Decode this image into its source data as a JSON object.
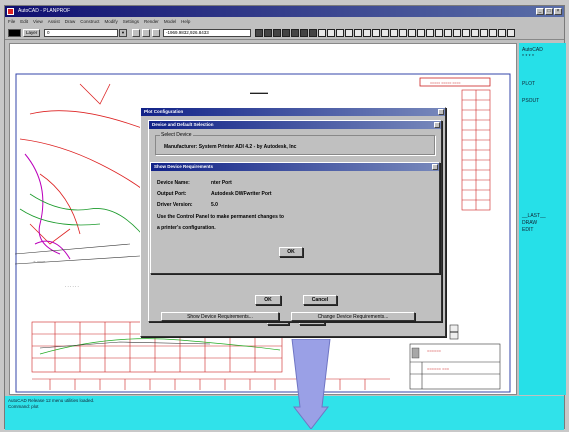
{
  "window": {
    "title": "AutoCAD - PLANPROF",
    "controls": [
      "_",
      "□",
      "×"
    ]
  },
  "menu": [
    "File",
    "Edit",
    "View",
    "Assist",
    "Draw",
    "Construct",
    "Modify",
    "Settings",
    "Render",
    "Model",
    "Help"
  ],
  "toolbar": {
    "layer_label": "Layer",
    "layer_value": "0",
    "coordinates": "-1969.9832,926.8433"
  },
  "side_menu": {
    "items": [
      "AutoCAD",
      "* * * *",
      "PLOT",
      "PSOUT",
      "__LAST__",
      "DRAW",
      "EDIT"
    ]
  },
  "command_area": {
    "line1": "AutoCAD Release 12 menu utilities loaded.",
    "line2": "Command: plot"
  },
  "plot_config": {
    "title": "Plot Configuration"
  },
  "device_selection": {
    "title": "Device and Default Selection",
    "group_label": "Select Device",
    "manufacturer": "Manufacturer:  System Printer ADI 4.2 - by Autodesk, Inc",
    "show_req_button": "Show Device Requirements...",
    "change_req_button": "Change Device Requirements...",
    "ok_button": "OK",
    "cancel_button": "Cancel"
  },
  "requirements": {
    "title": "Show Device Requirements",
    "device_name_label": "Device Name:",
    "device_name_value": "nter Port",
    "output_port_label": "Output Port:",
    "output_port_value": "Autodesk DWFwriter Port",
    "driver_version_label": "Driver Version:",
    "driver_version_value": "5.0",
    "note_line1": "Use the Control Panel to make permanent changes to",
    "note_line2": "a printer's configuration.",
    "ok_button": "OK"
  },
  "colors": {
    "title_bar": "#0f0f70",
    "side_menu": "#26e0e8",
    "dialog_face": "#c0c0c0",
    "pointer": "#9aa0e6"
  },
  "icons": [
    "app-icon",
    "close-icon",
    "minimize-icon",
    "maximize-icon",
    "pointer-arrow-icon"
  ]
}
